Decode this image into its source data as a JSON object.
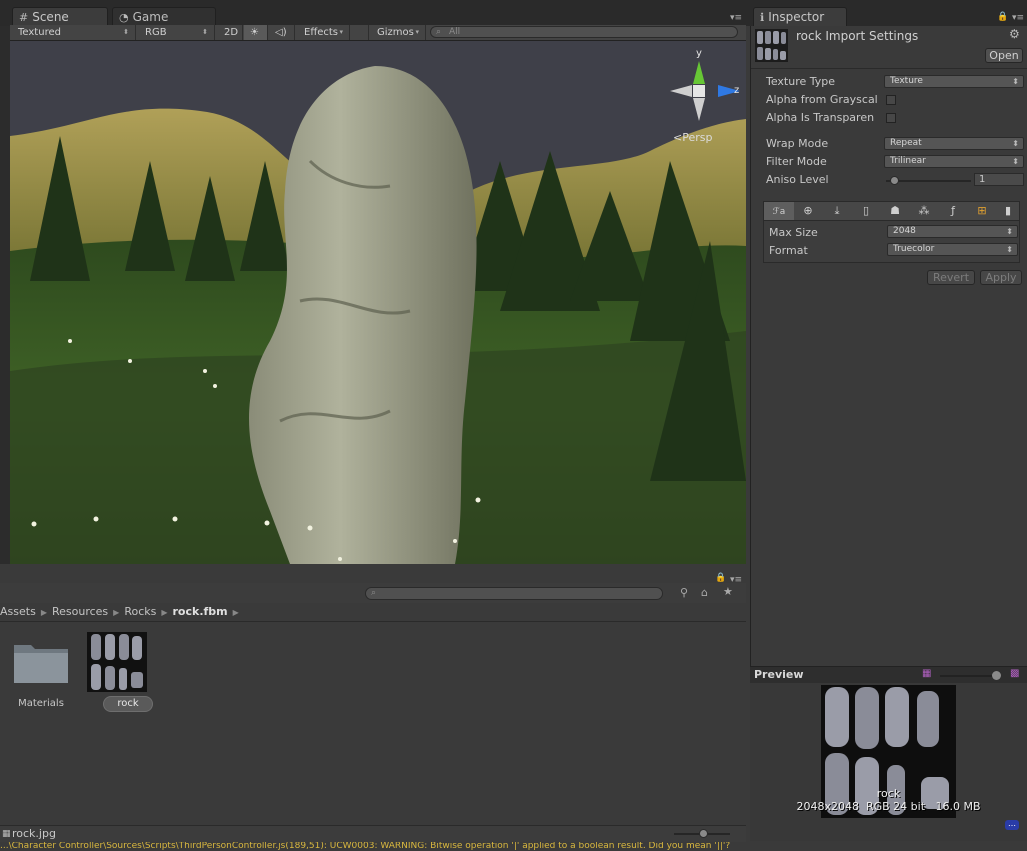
{
  "tabs": {
    "scene": "Scene",
    "game": "Game",
    "inspector": "Inspector"
  },
  "scene_toolbar": {
    "render_mode": "Textured",
    "color_mode": "RGB",
    "mode_2d": "2D",
    "effects": "Effects",
    "gizmos": "Gizmos",
    "search_placeholder": "All"
  },
  "gizmo": {
    "y_label": "y",
    "z_label": "z",
    "projection": "Persp"
  },
  "inspector": {
    "title": "rock Import Settings",
    "open_button": "Open",
    "texture_type_label": "Texture Type",
    "texture_type_value": "Texture",
    "alpha_grayscale_label": "Alpha from Grayscal",
    "alpha_transparent_label": "Alpha Is Transparen",
    "wrap_mode_label": "Wrap Mode",
    "wrap_mode_value": "Repeat",
    "filter_mode_label": "Filter Mode",
    "filter_mode_value": "Trilinear",
    "aniso_label": "Aniso Level",
    "aniso_value": "1",
    "aniso_fraction": 0.05,
    "max_size_label": "Max Size",
    "max_size_value": "2048",
    "format_label": "Format",
    "format_value": "Truecolor",
    "revert_button": "Revert",
    "apply_button": "Apply"
  },
  "platforms": [
    "default-icon",
    "web-icon",
    "standalone-icon",
    "ios-icon",
    "android-icon",
    "blackberry-icon",
    "flash-icon",
    "windows-store-icon",
    "windows-phone-icon"
  ],
  "project": {
    "breadcrumbs": [
      "Assets",
      "Resources",
      "Rocks",
      "rock.fbm"
    ],
    "items": [
      {
        "name": "Materials",
        "icon": "folder-icon"
      },
      {
        "name": "rock",
        "icon": "texture-thumbnail"
      }
    ],
    "selected_file": "rock.jpg",
    "zoom_fraction": 0.45
  },
  "preview": {
    "label": "Preview",
    "asset_name": "rock",
    "info": "2048x2048  RGB 24 bit   16.0 MB"
  },
  "console": {
    "message": "...\\Character Controller\\Sources\\Scripts\\ThirdPersonController.js(189,51): UCW0003: WARNING: Bitwise operation '|' applied to a boolean result. Did you mean '||'?"
  },
  "colors": {
    "console_warning": "#d9b83f",
    "gizmo_y": "#67c735",
    "gizmo_z": "#2f79e4",
    "selection": "#5a5a5a"
  }
}
